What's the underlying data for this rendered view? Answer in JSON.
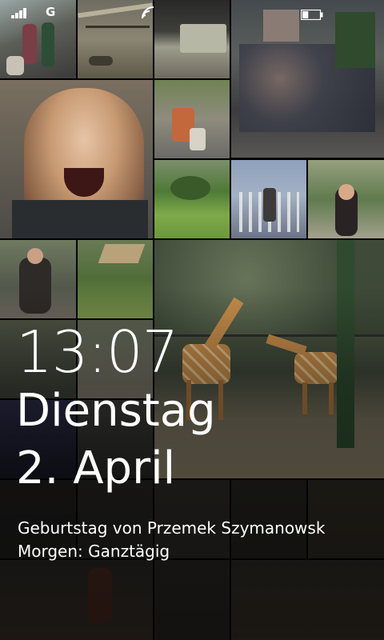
{
  "status": {
    "network": "G",
    "icons": [
      "signal-strength-icon",
      "wifi-icon",
      "battery-icon"
    ],
    "battery_level": 0.35
  },
  "lock": {
    "time": "13:07",
    "weekday": "Dienstag",
    "date": "2. April",
    "event_title": "Geburtstag von Przemek Szymanowsk",
    "event_time": "Morgen: Ganztägig"
  },
  "background": {
    "description_colors": {
      "sky": "#6f7a86",
      "foliage": "#3e5a2c",
      "ground": "#8a7a5e",
      "giraffe": "#b8833f",
      "water": "#7f95b2"
    }
  }
}
